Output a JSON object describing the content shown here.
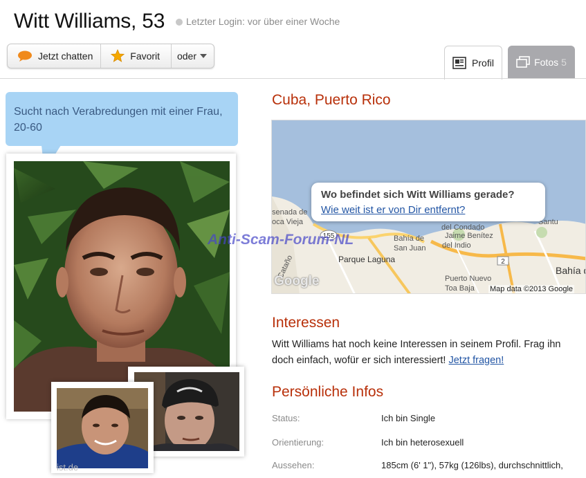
{
  "profile": {
    "name": "Witt Williams, 53",
    "last_login": "Letzter Login: vor über einer Woche"
  },
  "actions": {
    "chat_label": "Jetzt chatten",
    "favorite_label": "Favorit",
    "more_label": "oder"
  },
  "tabs": [
    {
      "label": "Profil",
      "active": true
    },
    {
      "label": "Fotos",
      "count": "5",
      "active": false
    }
  ],
  "bubble": {
    "text": "Sucht nach Verabredungen mit einer Frau, 20-60"
  },
  "photos": {
    "watermark_partial": "ist.de"
  },
  "location": {
    "title": "Cuba, Puerto Rico",
    "map_question": "Wo befindet sich Witt Williams gerade?",
    "map_link": "Wie weit ist er von Dir entfernt?",
    "map_credit": "Map data ©2013 Google",
    "map_logo": "Google",
    "map_labels": [
      "senada de",
      "oca Vieja",
      "Bahía de",
      "San Juan",
      "Cataño",
      "Parque Laguna",
      "del Condado",
      "Jaime Benítez",
      "del Indio",
      "Santu",
      "Bahía de",
      "Puerto Nuevo",
      "Toa Baja",
      "155",
      "2"
    ]
  },
  "overlay_watermark": "Anti-Scam-Forum-NL",
  "interests": {
    "title": "Interessen",
    "text": "Witt Williams hat noch keine Interessen in seinem Profil. Frag ihn doch einfach, wofür er sich interessiert!",
    "link": "Jetzt fragen!"
  },
  "personal": {
    "title": "Persönliche Infos",
    "rows": [
      {
        "label": "Status:",
        "value": "Ich bin Single"
      },
      {
        "label": "Orientierung:",
        "value": "Ich bin heterosexuell"
      },
      {
        "label": "Aussehen:",
        "value": "185cm (6' 1\"), 57kg (126lbs), durchschnittlich,"
      }
    ]
  },
  "colors": {
    "heading": "#b8300a",
    "link": "#2255a4",
    "bubble": "#a8d4f5",
    "bubble_text": "#3a5a82",
    "tab_inactive": "#a9a9ad"
  }
}
